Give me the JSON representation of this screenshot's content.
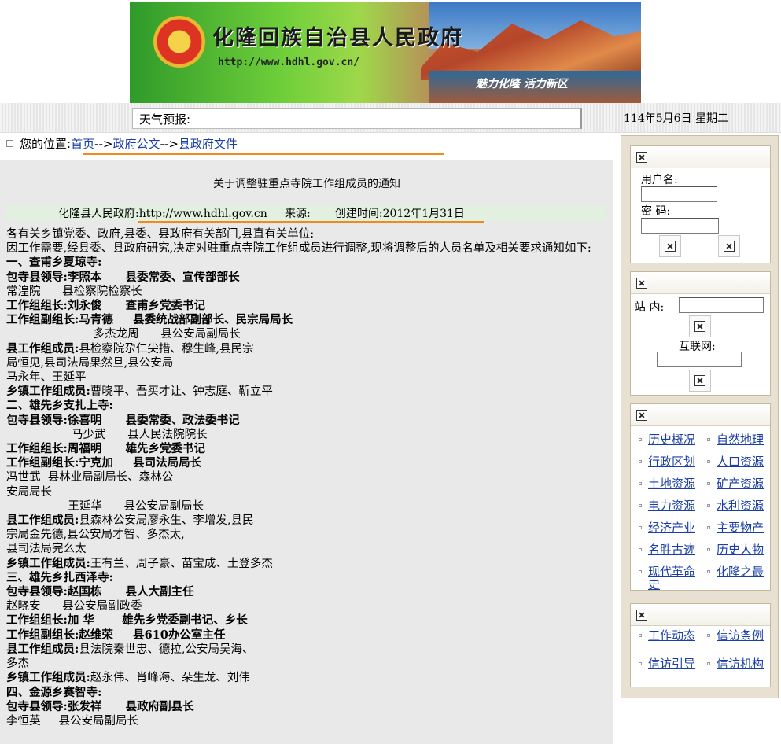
{
  "banner": {
    "title": "化隆回族自治县人民政府",
    "url": "http://www.hdhl.gov.cn/",
    "slogan": "魅力化隆 活力新区"
  },
  "weather": {
    "label": "天气预报:"
  },
  "date": "114年5月6日  星期二",
  "breadcrumb": {
    "prefix": "您的位置:",
    "items": [
      "首页",
      "政府公文",
      "县政府文件"
    ],
    "separator": "-->"
  },
  "article": {
    "title": "关于调整驻重点寺院工作组成员的通知",
    "meta": {
      "publisher": "化隆县人民政府:",
      "url": "http://www.hdhl.gov.cn",
      "source": "来源:",
      "created": "创建时间:2012年1月31日"
    },
    "lines": [
      {
        "t": "各有关乡镇党委、政府,县委、县政府有关部门,县直有关单位:",
        "b": false
      },
      {
        "t": "因工作需要,经县委、县政府研究,决定对驻重点寺院工作组成员进行调整,现将调整后的人员名单及相关要求通知如下:",
        "b": false,
        "wrap": true
      },
      {
        "t": "一、查甫乡夏琼寺:",
        "b": true
      },
      {
        "t": "包寺县领导:李照本      县委常委、宣传部部长",
        "b": true
      },
      {
        "t": "常湟院      县检察院检察长",
        "b": false
      },
      {
        "t": "工作组组长:刘永俊      查甫乡党委书记",
        "b": true
      },
      {
        "t": "工作组副组长:马青德     县委统战部副部长、民宗局局长",
        "b": true
      },
      {
        "t": "                        多杰龙周      县公安局副局长",
        "b": false
      },
      {
        "t": "县工作组成员:县检察院尕仁尖措、穆生峰,县民宗",
        "b": true,
        "mixed": "县工作组成员:"
      },
      {
        "t": "局恒见,县司法局果然旦,县公安局",
        "b": false
      },
      {
        "t": "马永年、王延平",
        "b": false
      },
      {
        "t": "乡镇工作组成员:曹晓平、吾买才让、钟志庭、靳立平",
        "b": true,
        "mixed": "乡镇工作组成员:"
      },
      {
        "t": "二、雄先乡支扎上寺:",
        "b": true
      },
      {
        "t": "包寺县领导:徐喜明      县委常委、政法委书记",
        "b": true
      },
      {
        "t": "                  马少武      县人民法院院长",
        "b": false
      },
      {
        "t": "工作组组长:周福明      雄先乡党委书记",
        "b": true
      },
      {
        "t": "工作组副组长:宁克加     县司法局局长",
        "b": true
      },
      {
        "t": "冯世武  县林业局副局长、森林公",
        "b": false
      },
      {
        "t": "安局局长",
        "b": false
      },
      {
        "t": "                 王延华      县公安局副局长",
        "b": false
      },
      {
        "t": "县工作组成员:县森林公安局廖永生、李增发,县民",
        "b": true,
        "mixed": "县工作组成员:"
      },
      {
        "t": "宗局金先德,县公安局才智、多杰太,",
        "b": false
      },
      {
        "t": "县司法局完么太",
        "b": false
      },
      {
        "t": "乡镇工作组成员:王有兰、周子豪、苗宝成、土登多杰",
        "b": true,
        "mixed": "乡镇工作组成员:"
      },
      {
        "t": "三、雄先乡扎西泽寺:",
        "b": true
      },
      {
        "t": "包寺县领导:赵国栋      县人大副主任",
        "b": true
      },
      {
        "t": "赵晓安      县公安局副政委",
        "b": false
      },
      {
        "t": "工作组组长:加 华       雄先乡党委副书记、乡长",
        "b": true
      },
      {
        "t": "工作组副组长:赵维荣     县610办公室主任",
        "b": true
      },
      {
        "t": "县工作组成员:县法院秦世忠、德拉,公安局吴海、",
        "b": true,
        "mixed": "县工作组成员:"
      },
      {
        "t": "多杰",
        "b": false
      },
      {
        "t": "乡镇工作组成员:赵永伟、肖峰海、朵生龙、刘伟",
        "b": true,
        "mixed": "乡镇工作组成员:"
      },
      {
        "t": "四、金源乡赛智寺:",
        "b": true
      },
      {
        "t": "包寺县领导:张发祥      县政府副县长",
        "b": true
      },
      {
        "t": "李恒英     县公安局副局长",
        "b": false
      }
    ]
  },
  "sidebar": {
    "login": {
      "username_label": "用户名:",
      "password_label": "密  码:"
    },
    "search": {
      "site_label": "站  内:",
      "web_label": "互联网:"
    },
    "links": [
      [
        "历史概况",
        "自然地理"
      ],
      [
        "行政区划",
        "人口资源"
      ],
      [
        "土地资源",
        "矿产资源"
      ],
      [
        "电力资源",
        "水利资源"
      ],
      [
        "经济产业",
        "主要物产"
      ],
      [
        "名胜古迹",
        "历史人物"
      ],
      [
        "现代革命史",
        "化隆之最"
      ]
    ],
    "petition_links": [
      [
        "工作动态",
        "信访条例"
      ],
      [
        "信访引导",
        "信访机构"
      ]
    ]
  }
}
